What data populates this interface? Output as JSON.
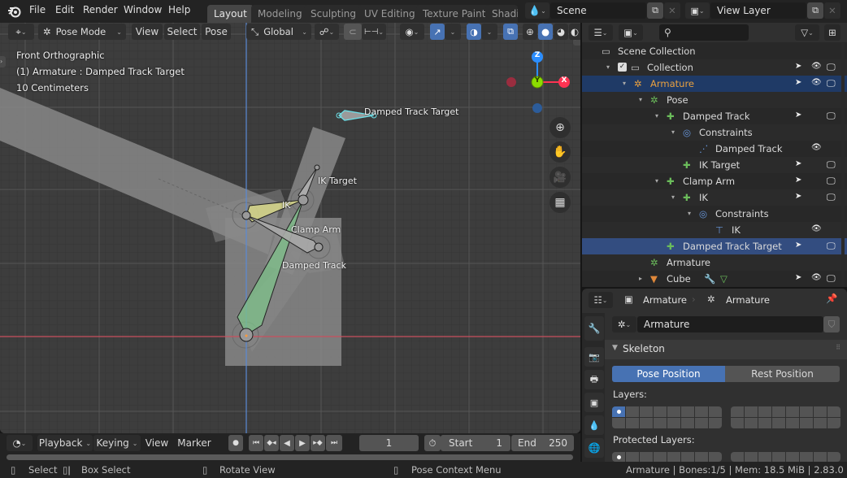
{
  "app": {
    "name": "Blender",
    "version": "2.83.0"
  },
  "topbar": {
    "menus": [
      "File",
      "Edit",
      "Render",
      "Window",
      "Help"
    ],
    "workspace_tabs": [
      {
        "label": "Layout",
        "active": true
      },
      {
        "label": "Modeling",
        "active": false
      },
      {
        "label": "Sculpting",
        "active": false
      },
      {
        "label": "UV Editing",
        "active": false
      },
      {
        "label": "Texture Paint",
        "active": false
      },
      {
        "label": "Shadir",
        "active": false
      }
    ],
    "scene": {
      "icon": "scene-icon",
      "value": "Scene"
    },
    "view_layer": {
      "icon": "view-layer-icon",
      "value": "View Layer"
    }
  },
  "viewport_header": {
    "editor_type_icon": "view3d-icon",
    "mode": "Pose Mode",
    "menus": [
      "View",
      "Select",
      "Pose"
    ],
    "transform_orientation": "Global",
    "pivot_icon": "pivot-icon",
    "snap_icon": "snap-icon",
    "proportional_icon": "proportional-icon",
    "visibility_icon": "eye-selectable-icon",
    "gizmo_icon": "gizmo-icon",
    "overlay_icon": "overlay-icon",
    "xray_icon": "xray-icon",
    "shading": [
      "wireframe",
      "solid",
      "material",
      "rendered"
    ],
    "shading_active": "solid"
  },
  "viewport": {
    "view_name": "Front Orthographic",
    "object_info": "(1) Armature : Damped Track Target",
    "grid_scale": "10 Centimeters",
    "axis_gizmo": {
      "z": "Z",
      "y": "Y",
      "x": "X"
    },
    "nav_buttons": [
      "zoom-icon",
      "hand-pan-icon",
      "camera-icon",
      "grid-ortho-icon"
    ],
    "bone_labels": [
      "Damped Track Target",
      "IK Target",
      "IK",
      "Clamp Arm",
      "Damped Track"
    ]
  },
  "outliner": {
    "search_placeholder": "",
    "rows": [
      {
        "label": "Scene Collection",
        "icon": "scene-collection-icon",
        "depth": 0,
        "expand": "",
        "state": "",
        "select": false,
        "eye": false,
        "monitor": false
      },
      {
        "label": "Collection",
        "icon": "collection-icon",
        "depth": 1,
        "expand": "▾",
        "state": "checked",
        "select": true,
        "eye": true,
        "monitor": true
      },
      {
        "label": "Armature",
        "icon": "armature-object-icon",
        "depth": 2,
        "expand": "▾",
        "state": "active",
        "select": true,
        "eye": true,
        "monitor": true
      },
      {
        "label": "Pose",
        "icon": "pose-icon",
        "depth": 3,
        "expand": "▾",
        "state": "",
        "select": false,
        "eye": false,
        "monitor": false
      },
      {
        "label": "Damped Track",
        "icon": "bone-icon",
        "depth": 4,
        "expand": "▾",
        "state": "",
        "select": true,
        "eye": false,
        "monitor": true
      },
      {
        "label": "Constraints",
        "icon": "constraint-icon",
        "depth": 5,
        "expand": "▾",
        "state": "",
        "select": false,
        "eye": false,
        "monitor": false
      },
      {
        "label": "Damped Track",
        "icon": "damped-track-icon",
        "depth": 6,
        "expand": "",
        "state": "",
        "select": false,
        "eye": true,
        "monitor": false
      },
      {
        "label": "IK Target",
        "icon": "bone-icon",
        "depth": 5,
        "expand": "",
        "state": "",
        "select": true,
        "eye": false,
        "monitor": true
      },
      {
        "label": "Clamp Arm",
        "icon": "bone-icon",
        "depth": 4,
        "expand": "▾",
        "state": "",
        "select": true,
        "eye": false,
        "monitor": true
      },
      {
        "label": "IK",
        "icon": "bone-icon",
        "depth": 5,
        "expand": "▾",
        "state": "",
        "select": true,
        "eye": false,
        "monitor": true
      },
      {
        "label": "Constraints",
        "icon": "constraint-icon",
        "depth": 6,
        "expand": "▾",
        "state": "",
        "select": false,
        "eye": false,
        "monitor": false
      },
      {
        "label": "IK",
        "icon": "ik-constraint-icon",
        "depth": 7,
        "expand": "",
        "state": "",
        "select": false,
        "eye": true,
        "monitor": false
      },
      {
        "label": "Damped Track Target",
        "icon": "bone-icon",
        "depth": 4,
        "expand": "",
        "state": "selected",
        "select": true,
        "eye": false,
        "monitor": true
      },
      {
        "label": "Armature",
        "icon": "armature-data-icon",
        "depth": 3,
        "expand": "",
        "state": "",
        "select": false,
        "eye": false,
        "monitor": false
      },
      {
        "label": "Cube",
        "icon": "mesh-object-icon",
        "depth": 3,
        "expand": "▸",
        "state": "",
        "select": true,
        "eye": true,
        "monitor": true,
        "extra_icons": [
          "wrench-icon",
          "mesh-data-icon"
        ]
      }
    ]
  },
  "properties": {
    "breadcrumb": [
      "Armature",
      "Armature"
    ],
    "data_name": "Armature",
    "tabs": [
      "tool-icon",
      "render-icon",
      "output-icon",
      "view-layer-icon",
      "scene-icon",
      "world-icon"
    ],
    "panel_title": "Skeleton",
    "pose_position": "Pose Position",
    "rest_position": "Rest Position",
    "active_position": "Pose Position",
    "layers_label": "Layers:",
    "protected_layers_label": "Protected Layers:",
    "active_layer": 1
  },
  "timeline": {
    "editor_icon": "clock-icon",
    "menus": [
      "Playback",
      "Keying",
      "View",
      "Marker"
    ],
    "current_frame": "1",
    "start_label": "Start",
    "start": "1",
    "end_label": "End",
    "end": "250"
  },
  "statusbar": {
    "hints": [
      {
        "icon": "mouse-left-icon",
        "label": "Select"
      },
      {
        "icon": "mouse-left-drag-icon",
        "label": "Box Select"
      },
      {
        "icon": "mouse-middle-icon",
        "label": "Rotate View"
      },
      {
        "icon": "mouse-right-icon",
        "label": "Pose Context Menu"
      }
    ],
    "info": "Armature | Bones:1/5  | Mem: 18.5 MiB | 2.83.0"
  },
  "colors": {
    "accent_blue": "#4772b3",
    "outliner_selected": "#334d80",
    "armature_orange": "#e8a040",
    "bone_green": "#6bbd5b",
    "axis_x": "#ff3352",
    "axis_y": "#8bdc00",
    "axis_z": "#2b8eff"
  }
}
